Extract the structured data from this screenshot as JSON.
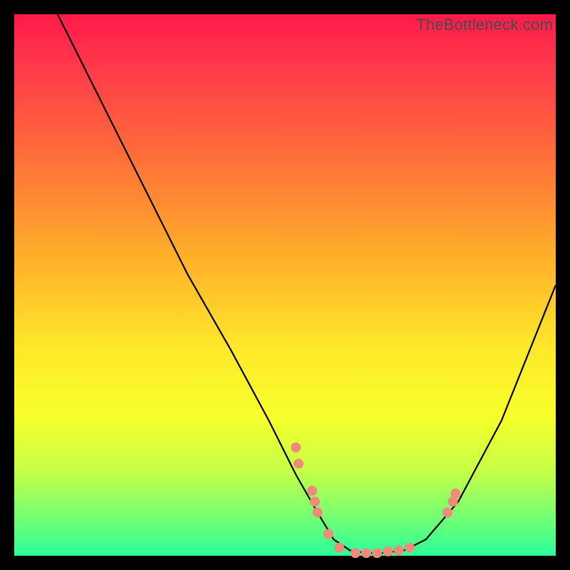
{
  "watermark": "TheBottleneck.com",
  "colors": {
    "dot": "#f08a7a",
    "curve": "#000000",
    "frame": "#000000"
  },
  "chart_data": {
    "type": "line",
    "title": "",
    "xlabel": "",
    "ylabel": "",
    "xlim": [
      0,
      100
    ],
    "ylim": [
      0,
      100
    ],
    "grid": false,
    "legend": false,
    "curve": {
      "x": [
        8,
        12,
        18,
        25,
        32,
        40,
        47,
        52,
        56,
        59,
        62,
        65,
        68,
        72,
        76,
        82,
        90,
        100
      ],
      "y": [
        100,
        92,
        80,
        66,
        52,
        38,
        25,
        15,
        8,
        3,
        1,
        0.5,
        0.5,
        1,
        3,
        10,
        25,
        50
      ]
    },
    "points": [
      {
        "x": 52,
        "y": 20
      },
      {
        "x": 52.5,
        "y": 17
      },
      {
        "x": 55,
        "y": 12
      },
      {
        "x": 55.5,
        "y": 10
      },
      {
        "x": 56,
        "y": 8
      },
      {
        "x": 58,
        "y": 4
      },
      {
        "x": 60,
        "y": 1.5
      },
      {
        "x": 63,
        "y": 0.5
      },
      {
        "x": 65,
        "y": 0.5
      },
      {
        "x": 67,
        "y": 0.5
      },
      {
        "x": 69,
        "y": 0.8
      },
      {
        "x": 71,
        "y": 1
      },
      {
        "x": 73,
        "y": 1.5
      },
      {
        "x": 80,
        "y": 8
      },
      {
        "x": 81,
        "y": 10
      },
      {
        "x": 81.5,
        "y": 11.5
      }
    ]
  }
}
